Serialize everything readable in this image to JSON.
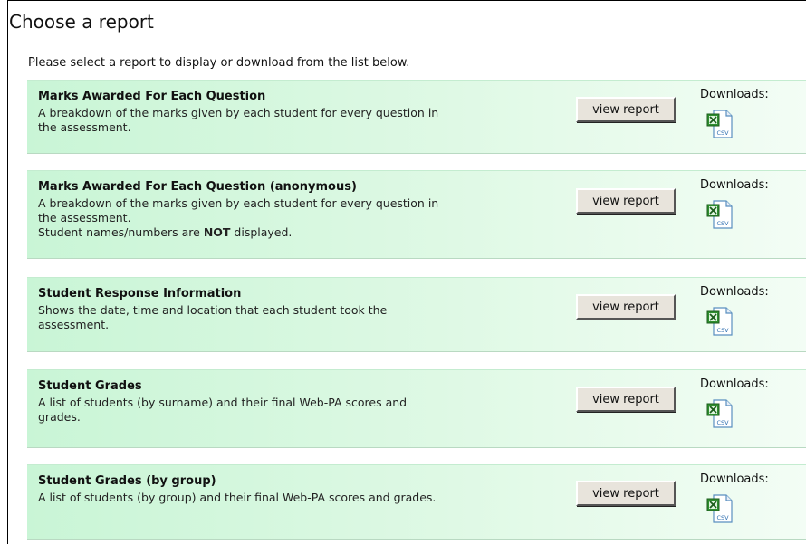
{
  "page": {
    "title": "Choose a report",
    "intro": "Please select a report to display or download from the list below."
  },
  "reports": [
    {
      "title": "Marks Awarded For Each Question",
      "description_lines": [
        "A breakdown of the marks given by each student for every question in",
        "the assessment."
      ],
      "button_label": "view report",
      "downloads_label": "Downloads:",
      "download_icon": "csv-file-icon",
      "download_text": "CSV"
    },
    {
      "title": "Marks Awarded For Each Question (anonymous)",
      "description_lines": [
        "A breakdown of the marks given by each student for every question in",
        "the assessment."
      ],
      "note_pre": "Student names/numbers are ",
      "note_bold": "NOT",
      "note_post": " displayed.",
      "button_label": "view report",
      "downloads_label": "Downloads:",
      "download_icon": "csv-file-icon",
      "download_text": "CSV"
    },
    {
      "title": "Student Response Information",
      "description_lines": [
        "Shows the date, time and location that each student took the",
        "assessment."
      ],
      "button_label": "view report",
      "downloads_label": "Downloads:",
      "download_icon": "csv-file-icon",
      "download_text": "CSV"
    },
    {
      "title": "Student Grades",
      "description_lines": [
        "A list of students (by surname) and their final Web-PA scores and",
        "grades."
      ],
      "button_label": "view report",
      "downloads_label": "Downloads:",
      "download_icon": "csv-file-icon",
      "download_text": "CSV"
    },
    {
      "title": "Student Grades (by group)",
      "description_lines": [
        "A list of students (by group) and their final Web-PA scores and grades."
      ],
      "button_label": "view report",
      "downloads_label": "Downloads:",
      "download_icon": "csv-file-icon",
      "download_text": "CSV"
    }
  ],
  "colors": {
    "panel_green": "#dff9e5",
    "button_face": "#e8e4dc",
    "excel_green": "#2f8f2f"
  }
}
